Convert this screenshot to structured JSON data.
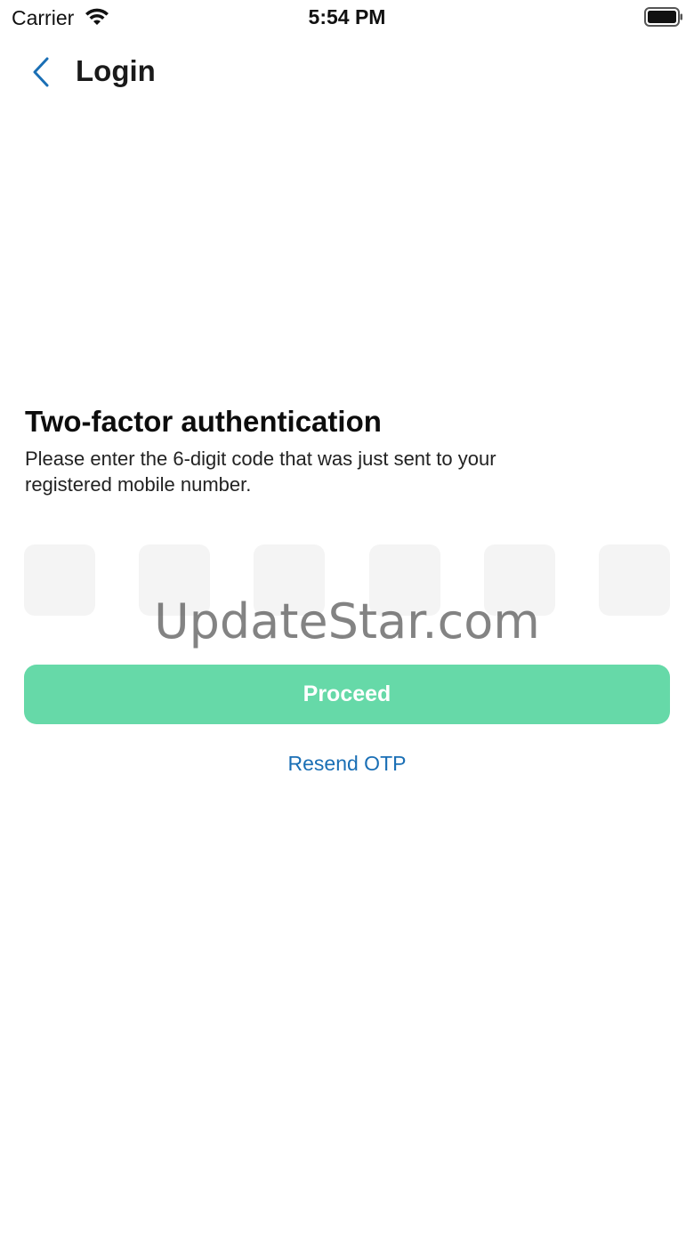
{
  "status_bar": {
    "carrier": "Carrier",
    "time": "5:54 PM",
    "wifi_icon": "wifi-icon",
    "battery_icon": "battery-icon"
  },
  "nav": {
    "back_icon": "chevron-left-icon",
    "title": "Login"
  },
  "content": {
    "heading": "Two-factor authentication",
    "subtitle": "Please enter the 6-digit code that was just sent to your registered mobile number.",
    "otp_fields": [
      "",
      "",
      "",
      "",
      "",
      ""
    ],
    "proceed_label": "Proceed",
    "resend_label": "Resend OTP"
  },
  "watermark": "UpdateStar.com",
  "colors": {
    "accent": "#1a6fb5",
    "proceed_bg": "#66d9a8",
    "otp_bg": "#f4f4f4"
  }
}
